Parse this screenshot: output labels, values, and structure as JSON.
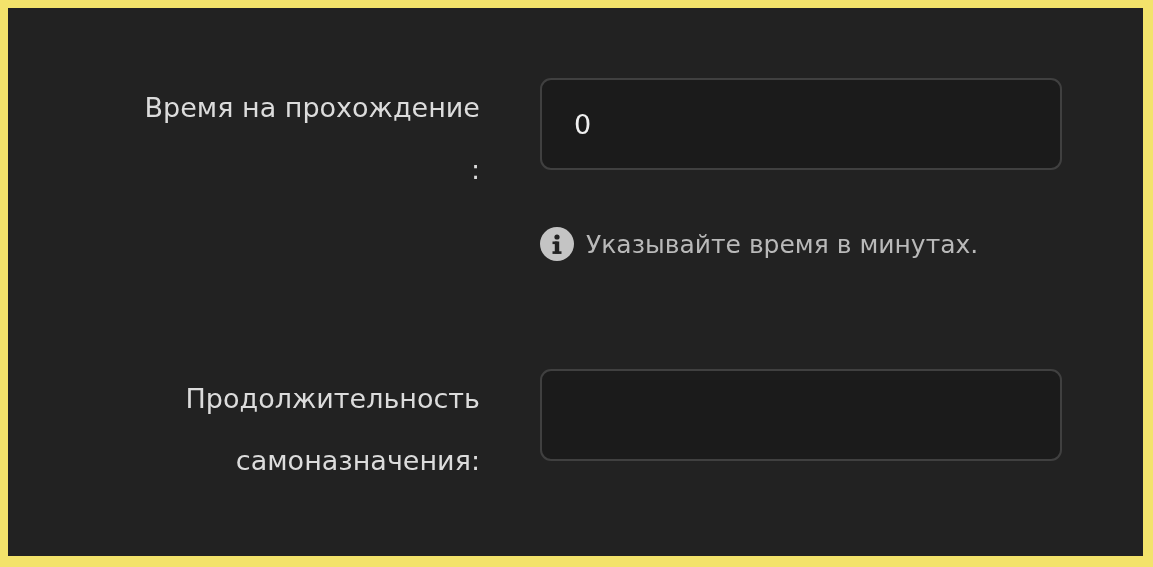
{
  "fields": [
    {
      "label_lines": [
        "Время на прохождение",
        ":"
      ],
      "value": "0",
      "hint": "Указывайте время в минутах."
    },
    {
      "label_lines": [
        "Продолжительность",
        "самоназначения:"
      ]
    }
  ]
}
